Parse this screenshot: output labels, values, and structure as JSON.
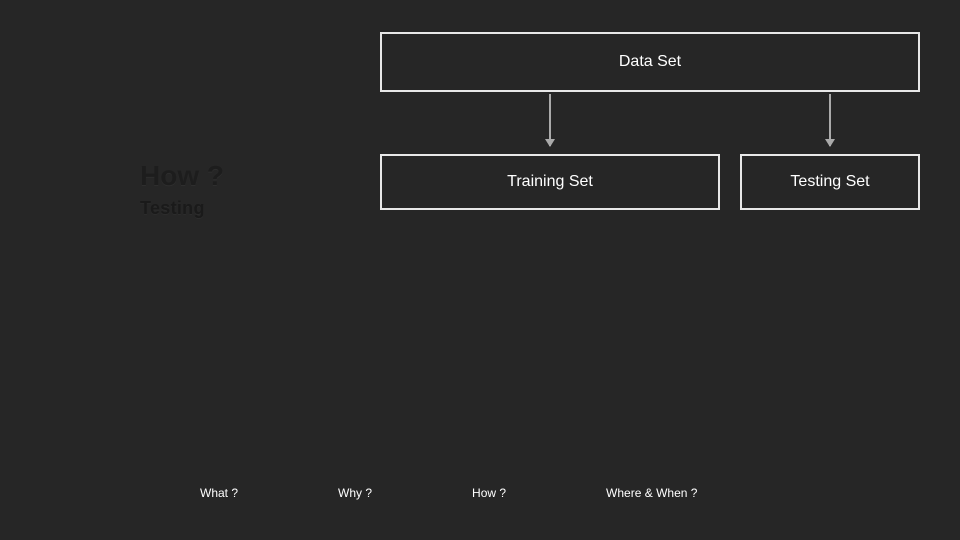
{
  "diagram": {
    "root": "Data Set",
    "children": {
      "left": "Training Set",
      "right": "Testing Set"
    }
  },
  "side_labels": {
    "heading": "How ?",
    "sub": "Testing"
  },
  "nav": {
    "items": [
      "What ?",
      "Why ?",
      "How ?",
      "Where & When ?"
    ]
  }
}
